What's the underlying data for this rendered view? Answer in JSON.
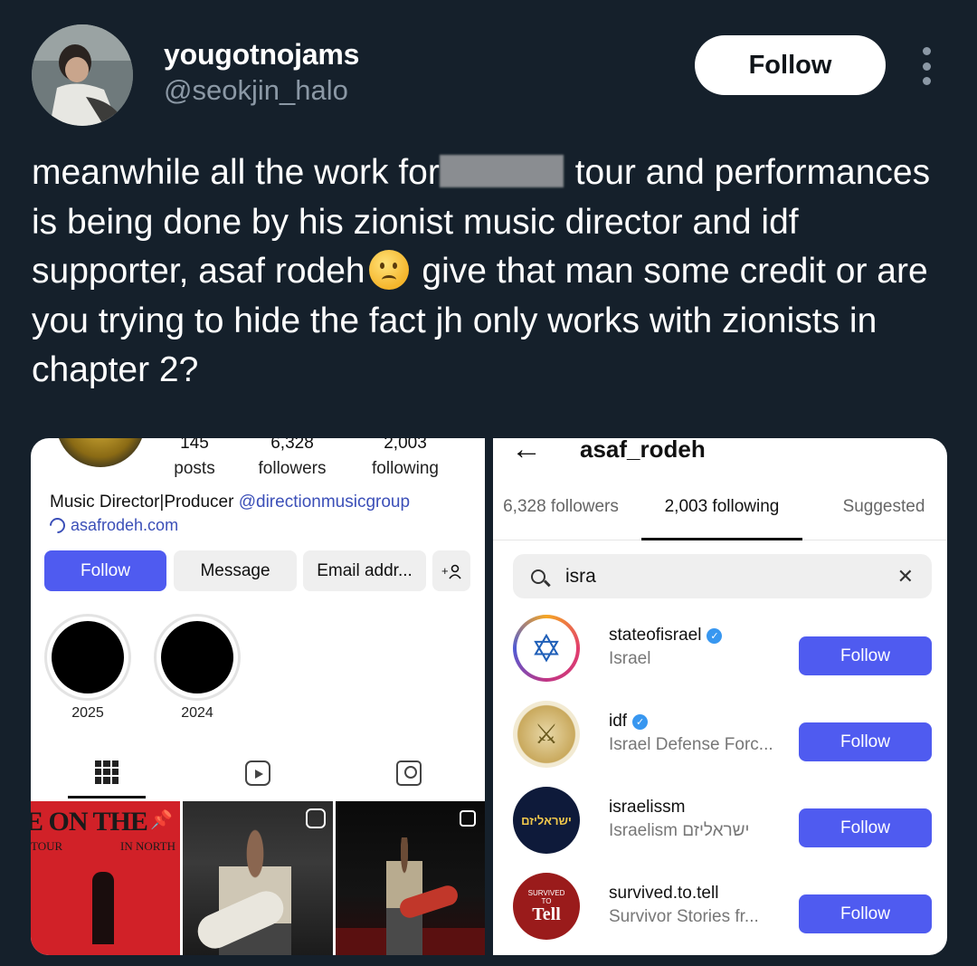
{
  "tweet": {
    "display_name": "yougotnojams",
    "handle": "@seokjin_halo",
    "follow_label": "Follow",
    "text_part1": "meanwhile all the work for",
    "text_part2": " tour and performances is being done by his zionist music director and idf supporter, asaf rodeh",
    "text_part3": " give that man some credit or are you trying to hide the fact jh only works with zionists in chapter 2?",
    "emoji": "confused-face-emoji"
  },
  "profile": {
    "stats": [
      {
        "value": "145",
        "label": "posts"
      },
      {
        "value": "6,328",
        "label": "followers"
      },
      {
        "value": "2,003",
        "label": "following"
      }
    ],
    "bio": "Music Director|Producer ",
    "bio_mention": "@directionmusicgroup",
    "link": "asafrodeh.com",
    "buttons": {
      "follow": "Follow",
      "message": "Message",
      "email": "Email addr...",
      "add_person": "+♀"
    },
    "highlights": [
      "2025",
      "2024"
    ],
    "thumbs": {
      "first_title": "E ON THE",
      "first_sub_left": "TOUR",
      "first_sub_right": "IN NORTH"
    }
  },
  "following": {
    "username": "asaf_rodeh",
    "tabs": [
      "6,328 followers",
      "2,003 following",
      "Suggested"
    ],
    "search_value": "isra",
    "clear_label": "✕",
    "accounts": [
      {
        "username": "stateofisrael",
        "verified": true,
        "subtitle": "Israel",
        "follow": "Follow",
        "avatar_text": "✡"
      },
      {
        "username": "idf",
        "verified": true,
        "subtitle": "Israel Defense Forc...",
        "follow": "Follow",
        "avatar_text": "⚔"
      },
      {
        "username": "israelissm",
        "verified": false,
        "subtitle": "Israelism ישראליזם",
        "follow": "Follow",
        "avatar_text": "ישראליזם"
      },
      {
        "username": "survived.to.tell",
        "verified": false,
        "subtitle": "Survivor Stories fr...",
        "follow": "Follow",
        "avatar_top": "SURVIVED",
        "avatar_mid": "TO",
        "avatar_text": "Tell"
      }
    ]
  }
}
